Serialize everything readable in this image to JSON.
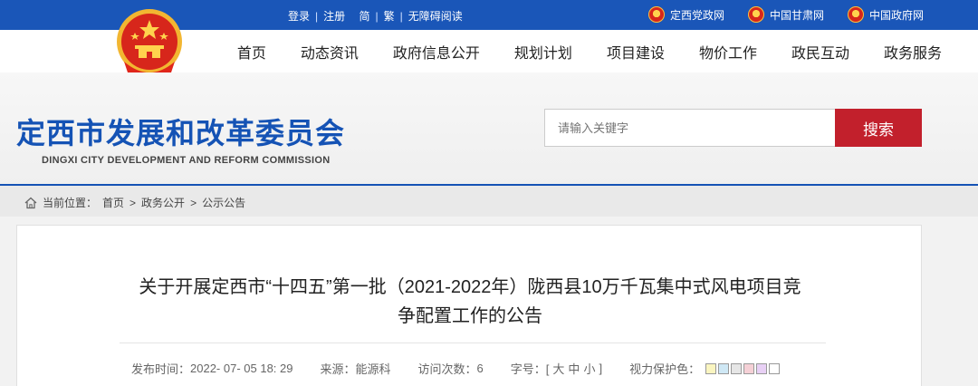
{
  "topbar": {
    "links": [
      "登录",
      "注册",
      "简",
      "繁",
      "无障碍阅读"
    ],
    "external": [
      {
        "label": "定西党政网"
      },
      {
        "label": "中国甘肃网"
      },
      {
        "label": "中国政府网"
      }
    ]
  },
  "nav": [
    "首页",
    "动态资讯",
    "政府信息公开",
    "规划计划",
    "项目建设",
    "物价工作",
    "政民互动",
    "政务服务"
  ],
  "header": {
    "title": "定西市发展和改革委员会",
    "subtitle": "DINGXI CITY DEVELOPMENT AND REFORM COMMISSION",
    "search_placeholder": "请输入关键字",
    "search_button": "搜索"
  },
  "breadcrumb": {
    "prefix": "当前位置：",
    "items": [
      "首页",
      "政务公开",
      "公示公告"
    ],
    "separator": " > "
  },
  "article": {
    "title_line1": "关于开展定西市“十四五”第一批（2021-2022年）陇西县10万千瓦集中式风电项目竞",
    "title_line2": "争配置工作的公告",
    "publish_label": "发布时间：",
    "publish_value": "2022- 07- 05 18: 29",
    "source_label": "来源：",
    "source_value": "能源科",
    "visits_label": "访问次数：",
    "visits_value": "6",
    "fontsize_label": "字号：[",
    "fontsize_large": "大",
    "fontsize_medium": "中",
    "fontsize_small": "小",
    "fontsize_close": "]",
    "eyecare_label": "视力保护色：",
    "eyecare_colors": [
      "#faf5c0",
      "#cfe8f5",
      "#e6e6e6",
      "#f5d0d6",
      "#e8d0f5",
      "#ffffff"
    ]
  },
  "colors": {
    "topbar": "#1a56b8",
    "title_blue": "#1553b5",
    "search_red": "#c2202c"
  }
}
